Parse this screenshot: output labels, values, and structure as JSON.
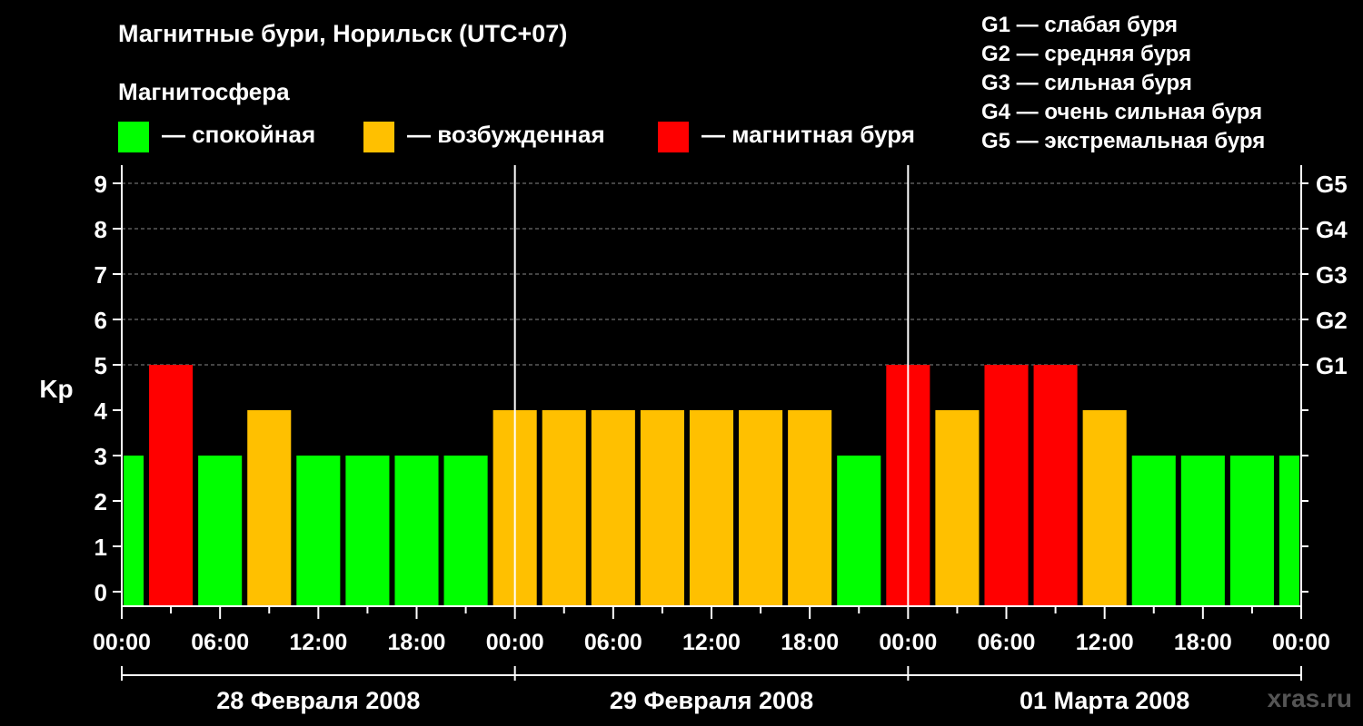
{
  "title": "Магнитные бури, Норильск (UTC+07)",
  "subtitle": "Магнитосфера",
  "legend": [
    {
      "label": "— спокойная",
      "color": "#00ff00"
    },
    {
      "label": "— возбужденная",
      "color": "#ffc000"
    },
    {
      "label": "— магнитная буря",
      "color": "#ff0000"
    }
  ],
  "g_legend": [
    "G1 — слабая буря",
    "G2 — средняя буря",
    "G3 — сильная буря",
    "G4 — очень сильная буря",
    "G5 — экстремальная буря"
  ],
  "watermark": "xras.ru",
  "chart_data": {
    "type": "bar",
    "ylabel": "Kp",
    "ylim": [
      0,
      9
    ],
    "yticks": [
      "0",
      "1",
      "2",
      "3",
      "4",
      "5",
      "6",
      "7",
      "8",
      "9"
    ],
    "right_ticks": [
      {
        "value": 5,
        "label": "G1"
      },
      {
        "value": 6,
        "label": "G2"
      },
      {
        "value": 7,
        "label": "G3"
      },
      {
        "value": 8,
        "label": "G4"
      },
      {
        "value": 9,
        "label": "G5"
      }
    ],
    "x_tick_labels": [
      "00:00",
      "06:00",
      "12:00",
      "18:00",
      "00:00",
      "06:00",
      "12:00",
      "18:00",
      "00:00",
      "06:00",
      "12:00",
      "18:00",
      "00:00"
    ],
    "days": [
      "28 Февраля 2008",
      "29 Февраля 2008",
      "01 Марта 2008"
    ],
    "bar_interval_hours": 3,
    "values": [
      3,
      5,
      3,
      4,
      3,
      3,
      3,
      3,
      4,
      4,
      4,
      4,
      4,
      4,
      4,
      3,
      5,
      4,
      5,
      5,
      4,
      3,
      3,
      3,
      3
    ],
    "colors": {
      "quiet": "#00ff00",
      "active": "#ffc000",
      "storm": "#ff0000"
    },
    "grid": true
  }
}
